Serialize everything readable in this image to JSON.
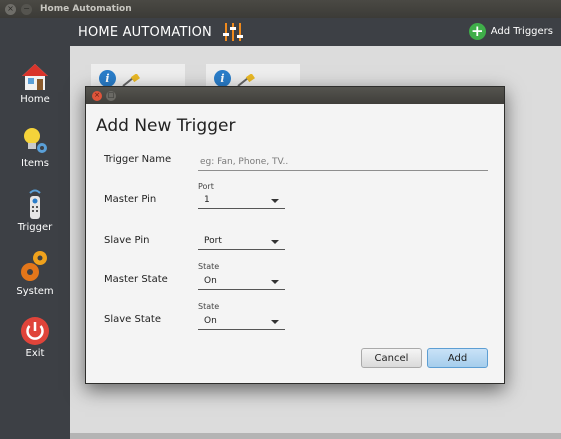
{
  "window": {
    "title": "Home Automation",
    "close_glyph": "×",
    "min_glyph": "−"
  },
  "header": {
    "title": "HOME AUTOMATION",
    "add_triggers_label": "Add Triggers",
    "add_glyph": "+"
  },
  "sidebar": {
    "items": [
      {
        "label": "Home",
        "icon": "house-icon"
      },
      {
        "label": "Items",
        "icon": "lightbulb-icon"
      },
      {
        "label": "Trigger",
        "icon": "remote-icon"
      },
      {
        "label": "System",
        "icon": "gears-icon"
      },
      {
        "label": "Exit",
        "icon": "power-icon"
      }
    ]
  },
  "cards": [
    {
      "info_glyph": "i",
      "icon": "plug-icon"
    },
    {
      "info_glyph": "i",
      "icon": "plug-icon"
    }
  ],
  "dialog": {
    "title": "Add New Trigger",
    "close_glyph": "×",
    "max_glyph": "□",
    "fields": {
      "trigger_name": {
        "label": "Trigger Name",
        "placeholder": "eg: Fan, Phone, TV..",
        "value": ""
      },
      "master_pin": {
        "label": "Master Pin",
        "float_label": "Port",
        "value": "1"
      },
      "slave_pin": {
        "label": "Slave Pin",
        "value": "Port"
      },
      "master_state": {
        "label": "Master State",
        "float_label": "State",
        "value": "On"
      },
      "slave_state": {
        "label": "Slave State",
        "float_label": "State",
        "value": "On"
      }
    },
    "buttons": {
      "cancel": "Cancel",
      "add": "Add"
    }
  },
  "colors": {
    "sidebar_bg": "#3d4045",
    "add_green": "#3fae49",
    "info_blue": "#2a7dc9",
    "exit_red": "#e0443a",
    "accent_orange": "#f08a1c"
  }
}
